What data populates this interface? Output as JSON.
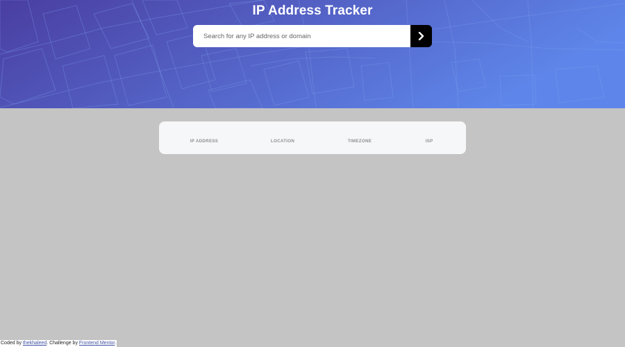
{
  "header": {
    "title": "IP Address Tracker",
    "gradient": [
      "#4a3ea1",
      "#5e86ea"
    ]
  },
  "search": {
    "placeholder": "Search for any IP address or domain",
    "value": "",
    "submit_icon": "chevron-right-icon"
  },
  "info": [
    {
      "label": "IP ADDRESS",
      "value": ""
    },
    {
      "label": "LOCATION",
      "value": ""
    },
    {
      "label": "TIMEZONE",
      "value": ""
    },
    {
      "label": "ISP",
      "value": ""
    }
  ],
  "footer": {
    "prefix": "Coded by ",
    "author_link": "thekhaleed",
    "middle": ". Challenge by ",
    "challenge_link": "Frontend Mentor",
    "suffix": "."
  },
  "colors": {
    "page_background": "#c4c4c4",
    "card_background": "#f6f7f9",
    "label_gray": "#8f8f8f",
    "button_black": "#000000"
  }
}
